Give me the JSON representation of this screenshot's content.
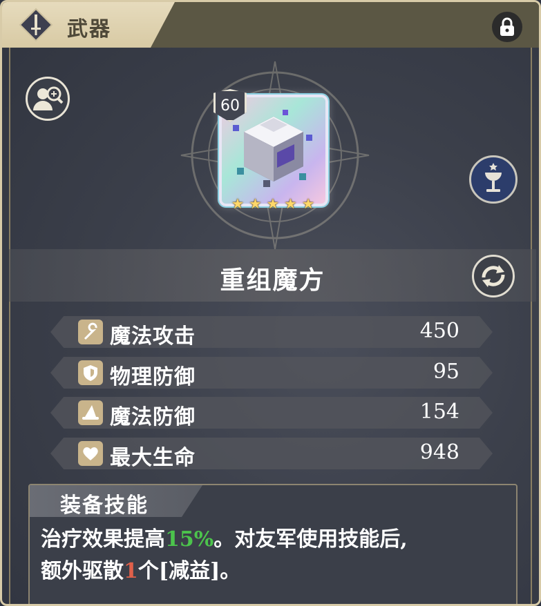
{
  "header": {
    "title": "武器",
    "category_icon": "sword-icon",
    "lock_icon": "lock-icon"
  },
  "weapon": {
    "name": "重组魔方",
    "level": "60",
    "stars": 5,
    "star_glyph": "★",
    "art_icon": "magic-cube-icon",
    "rarity_colors": {
      "frame": "#e8e6f5",
      "glow": "#8ad1e3"
    }
  },
  "buttons": {
    "view_icon": "character-search-icon",
    "grail_icon": "grail-icon",
    "swap_icon": "swap-icon"
  },
  "stats": [
    {
      "label": "魔法攻击",
      "value": "450",
      "icon": "staff-icon"
    },
    {
      "label": "物理防御",
      "value": "95",
      "icon": "shield-icon"
    },
    {
      "label": "魔法防御",
      "value": "154",
      "icon": "witch-hat-icon"
    },
    {
      "label": "最大生命",
      "value": "948",
      "icon": "heart-icon"
    }
  ],
  "skill": {
    "title": "装备技能",
    "desc_part1": "治疗效果提高",
    "desc_highlight1": "15%",
    "desc_part2": "。对友军使用技能后,",
    "desc_part3": "额外驱散",
    "desc_highlight2": "1",
    "desc_part4": "个[减益]。"
  },
  "colors": {
    "highlight_green": "#4cc44c",
    "highlight_red": "#e0604a",
    "header_tab": "#e6dbbd"
  }
}
